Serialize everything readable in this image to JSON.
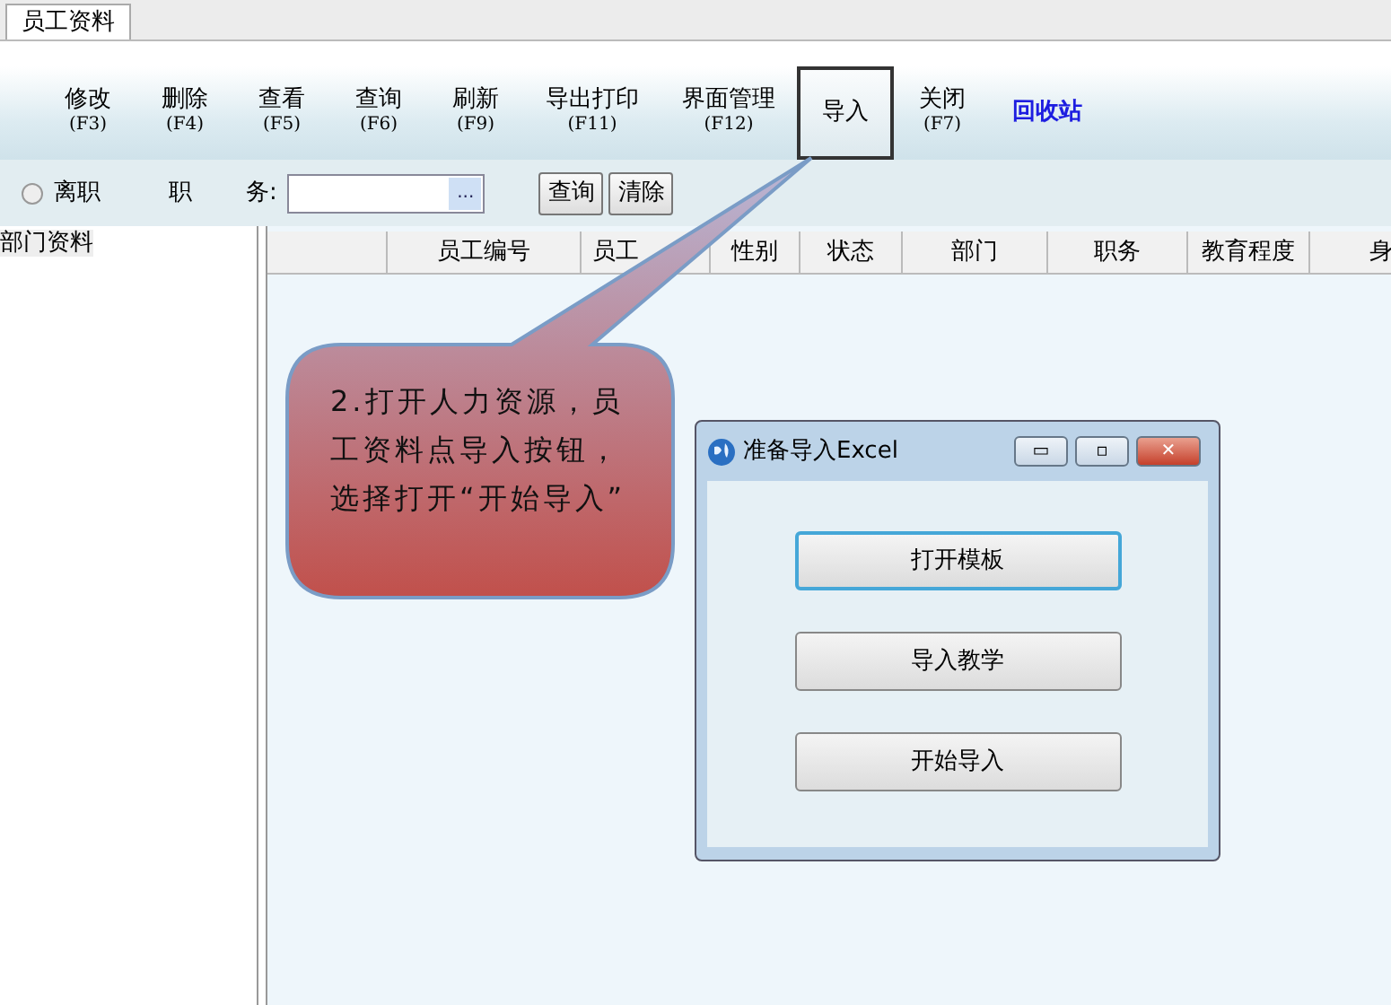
{
  "tabs": [
    {
      "label": "员工资料",
      "selected": true
    }
  ],
  "toolbar": [
    {
      "kind": "command",
      "label": "修改",
      "shortcut": "(F3)",
      "selected": false
    },
    {
      "kind": "command",
      "label": "删除",
      "shortcut": "(F4)",
      "selected": false
    },
    {
      "kind": "command",
      "label": "查看",
      "shortcut": "(F5)",
      "selected": false
    },
    {
      "kind": "command",
      "label": "查询",
      "shortcut": "(F6)",
      "selected": false
    },
    {
      "kind": "command",
      "label": "刷新",
      "shortcut": "(F9)",
      "selected": false
    },
    {
      "kind": "command",
      "label": "导出打印",
      "shortcut": "(F11)",
      "selected": false
    },
    {
      "kind": "command",
      "label": "界面管理",
      "shortcut": "(F12)",
      "selected": false
    },
    {
      "kind": "command",
      "label": "导入",
      "selected": true
    },
    {
      "kind": "command",
      "label": "关闭",
      "shortcut": "(F7)",
      "selected": false
    },
    {
      "kind": "link",
      "label": "回收站",
      "selected": false
    }
  ],
  "filter": {
    "radio": {
      "label": "离职",
      "checked": false
    },
    "field_label_1": "职",
    "field_label_2": "务:",
    "browse_button": "...",
    "buttons": [
      "查询",
      "清除"
    ]
  },
  "sidebar": {
    "title": "部门资料"
  },
  "table": {
    "columns": [
      "",
      "员工编号",
      "员工",
      "性别",
      "状态",
      "部门",
      "职务",
      "教育程度",
      "身"
    ]
  },
  "callout": {
    "text": "2.打开人力资源，员工资料点导入按钮，选择打开“开始导入”"
  },
  "dialog": {
    "title": "准备导入Excel",
    "controls": [
      "▭",
      "▫",
      "✕"
    ],
    "buttons": [
      {
        "label": "打开模板",
        "focused": true
      },
      {
        "label": "导入教学",
        "focused": false
      },
      {
        "label": "开始导入",
        "focused": false
      }
    ]
  }
}
